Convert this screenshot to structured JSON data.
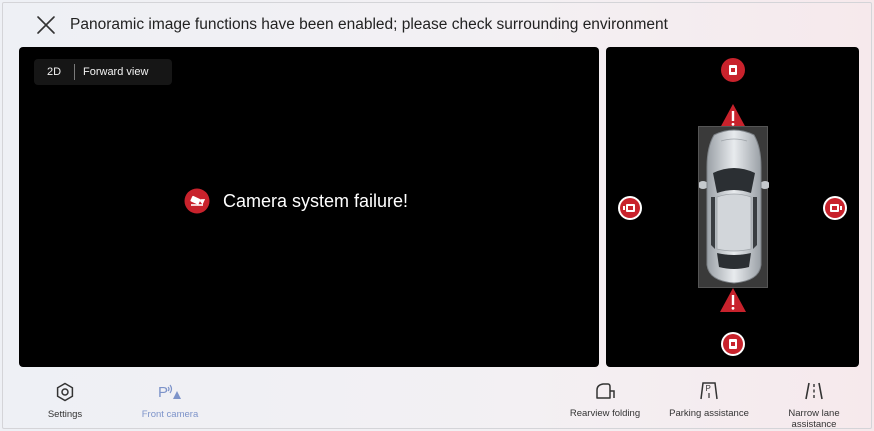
{
  "header": {
    "title": "Panoramic image functions have been enabled; please check surrounding environment",
    "close_icon": "close-icon"
  },
  "main_view": {
    "mode_label": "2D",
    "view_label": "Forward view",
    "failure_message": "Camera system failure!",
    "failure_icon": "camera-off-icon"
  },
  "side_view": {
    "camera_buttons": [
      "front-camera",
      "left-camera",
      "right-camera",
      "rear-camera"
    ],
    "warnings": [
      "front-warning",
      "rear-warning"
    ]
  },
  "toolbar": {
    "settings_label": "Settings",
    "front_camera_label": "Front camera",
    "rearview_folding_label": "Rearview folding",
    "parking_assistance_label": "Parking assistance",
    "narrow_lane_label": "Narrow lane assistance",
    "active_item": "front_camera"
  },
  "colors": {
    "alert_red": "#c8222c",
    "active_blue": "#7d93c9",
    "panel_black": "#000000"
  }
}
